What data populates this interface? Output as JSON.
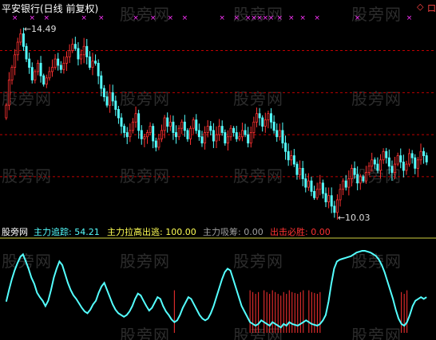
{
  "title": "平安银行(日线 前复权)",
  "controls": {
    "settings_symbol": "◇",
    "window_symbol": "口"
  },
  "watermark": "股旁网",
  "colors": {
    "background": "#000000",
    "up_candle": "#ff3232",
    "down_candle": "#54ffff",
    "reference_line": "#c00000",
    "signal_marker": "#ff33ff",
    "indicator_line": "#54ffff",
    "indicator_bars": "#ff3232",
    "separator": "#d0d040"
  },
  "annotations": {
    "high_label": "14.49",
    "low_label": "10.03"
  },
  "indicator_panel": {
    "name": "股旁网",
    "items": [
      {
        "label": "主力追踪:",
        "value": "54.21",
        "color": "#54ffff"
      },
      {
        "label": "主力拉高出逃:",
        "value": "100.00",
        "color": "#ffff54"
      },
      {
        "label": "主力吸筹:",
        "value": "0.00",
        "color": "#a0a0a0"
      },
      {
        "label": "出击必胜:",
        "value": "0.00",
        "color": "#ff3232"
      }
    ]
  },
  "chart_data": [
    {
      "type": "candlestick",
      "series_name": "平安银行",
      "high_marker": 14.49,
      "low_marker": 10.03,
      "ylim": [
        9.9,
        14.9
      ],
      "reference_lines": [
        14.0,
        13.0,
        12.0,
        11.0
      ],
      "closes": [
        12.7,
        13.3,
        13.6,
        13.9,
        14.2,
        14.4,
        14.1,
        13.8,
        13.6,
        13.3,
        13.5,
        13.7,
        13.4,
        13.2,
        13.35,
        13.5,
        13.6,
        13.8,
        13.65,
        13.55,
        13.7,
        13.85,
        14.0,
        14.15,
        14.05,
        13.8,
        13.9,
        14.1,
        13.85,
        13.6,
        13.75,
        13.7,
        13.4,
        13.1,
        12.9,
        12.7,
        13.0,
        12.8,
        12.6,
        12.4,
        12.2,
        12.05,
        11.95,
        12.1,
        12.3,
        12.5,
        12.1,
        11.9,
        11.95,
        12.05,
        12.2,
        11.85,
        11.7,
        11.9,
        12.1,
        12.4,
        12.2,
        12.3,
        12.05,
        11.95,
        12.15,
        12.3,
        12.1,
        11.9,
        12.15,
        12.35,
        12.1,
        11.95,
        11.8,
        12.05,
        12.2,
        12.1,
        11.85,
        12.0,
        12.2,
        12.05,
        11.8,
        11.95,
        12.15,
        12.05,
        11.9,
        11.95,
        12.1,
        12.0,
        11.8,
        12.05,
        12.3,
        12.5,
        12.4,
        12.2,
        12.35,
        12.5,
        12.3,
        12.1,
        11.95,
        12.1,
        11.8,
        11.6,
        11.4,
        11.5,
        11.3,
        11.05,
        11.2,
        10.95,
        10.75,
        10.9,
        10.65,
        10.5,
        10.7,
        10.85,
        10.6,
        10.4,
        10.55,
        10.3,
        10.15,
        10.45,
        10.7,
        10.9,
        10.75,
        10.95,
        11.2,
        11.05,
        10.85,
        11.0,
        10.9,
        11.1,
        11.25,
        11.4,
        11.3,
        11.15,
        11.4,
        11.6,
        11.45,
        11.25,
        11.1,
        11.3,
        11.5,
        11.35,
        11.15,
        11.3,
        11.55,
        11.45,
        11.2,
        11.4,
        11.6,
        11.5,
        11.35
      ]
    },
    {
      "type": "line",
      "series_name": "主力追踪",
      "ylim": [
        0,
        100
      ],
      "values": [
        35,
        48,
        60,
        70,
        78,
        85,
        88,
        80,
        72,
        62,
        55,
        45,
        40,
        36,
        30,
        36,
        48,
        62,
        72,
        80,
        76,
        66,
        56,
        48,
        42,
        38,
        33,
        28,
        24,
        22,
        26,
        32,
        36,
        45,
        52,
        56,
        48,
        40,
        32,
        26,
        22,
        20,
        18,
        20,
        24,
        30,
        38,
        44,
        42,
        36,
        30,
        25,
        28,
        34,
        40,
        38,
        30,
        24,
        20,
        15,
        12,
        14,
        20,
        28,
        34,
        40,
        38,
        32,
        26,
        20,
        16,
        14,
        16,
        22,
        30,
        40,
        50,
        60,
        68,
        72,
        70,
        60,
        50,
        40,
        30,
        24,
        18,
        12,
        10,
        8,
        10,
        14,
        12,
        10,
        8,
        12,
        10,
        8,
        6,
        10,
        8,
        12,
        10,
        9,
        8,
        10,
        12,
        14,
        12,
        10,
        9,
        8,
        10,
        14,
        20,
        35,
        55,
        72,
        80,
        82,
        83,
        84,
        85,
        86,
        88,
        90,
        91,
        92,
        92,
        91,
        90,
        88,
        86,
        82,
        76,
        68,
        58,
        48,
        38,
        26,
        16,
        10,
        8,
        12,
        20,
        30,
        36,
        38,
        40,
        38,
        40
      ]
    }
  ]
}
